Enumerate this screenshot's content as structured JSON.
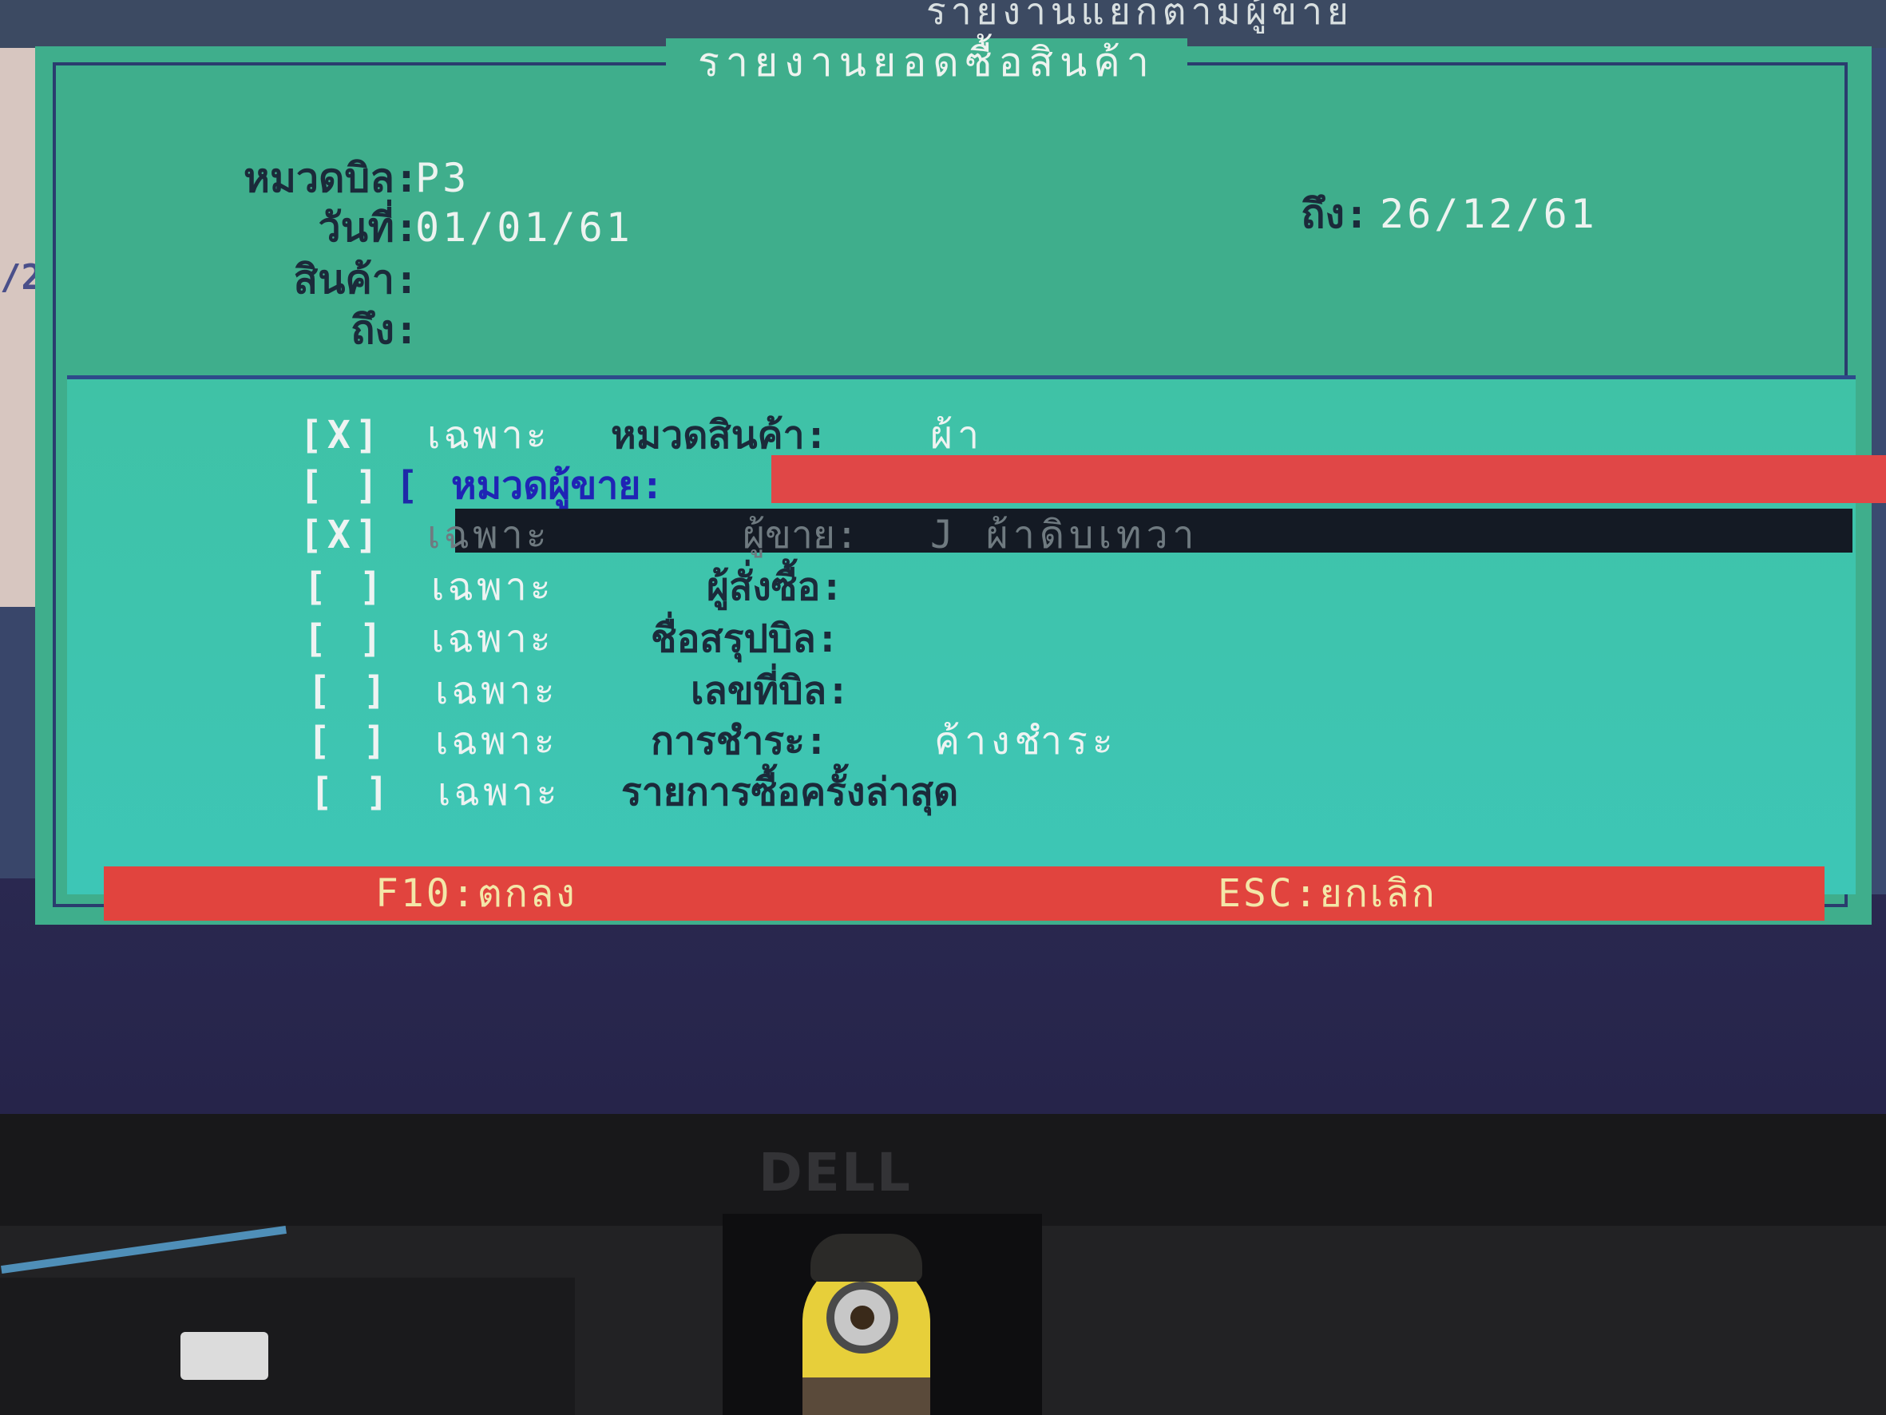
{
  "background": {
    "window_title": "รายงานแยกตามผู้ขาย",
    "left_fragment": "/2"
  },
  "dialog": {
    "title": "รายงานยอดซื้อสินค้า",
    "fields": {
      "bill_category_label": "หมวดบิล:",
      "bill_category_value": "P3",
      "date_label": "วันที่:",
      "date_from_value": "01/01/61",
      "date_to_label": "ถึง:",
      "date_to_value": "26/12/61",
      "product_label": "สินค้า:",
      "product_value": "",
      "product_to_label": "ถึง:",
      "product_to_value": ""
    },
    "options": [
      {
        "check": "[X]",
        "only": "เฉพาะ",
        "label": "หมวดสินค้า:",
        "value": "ผ้า"
      },
      {
        "check": "[ ]",
        "only": "",
        "label": "หมวดผู้ขาย:",
        "value": ""
      },
      {
        "check": "[X]",
        "only": "เฉพาะ",
        "label": "ผู้ขาย:",
        "value": "J ผ้าดิบเทวา"
      },
      {
        "check": "[ ]",
        "only": "เฉพาะ",
        "label": "ผู้สั่งซื้อ:",
        "value": ""
      },
      {
        "check": "[ ]",
        "only": "เฉพาะ",
        "label": "ชื่อสรุปบิล:",
        "value": ""
      },
      {
        "check": "[ ]",
        "only": "เฉพาะ",
        "label": "เลขที่บิล:",
        "value": ""
      },
      {
        "check": "[ ]",
        "only": "เฉพาะ",
        "label": "การชำระ:",
        "value": "ค้างชำระ"
      },
      {
        "check": "[ ]",
        "only": "เฉพาะ",
        "label": "รายการซื้อครั้งล่าสุด",
        "value": ""
      }
    ],
    "focus_bracket": "[",
    "footer": {
      "ok": "F10:ตกลง",
      "cancel": "ESC:ยกเลิก"
    }
  },
  "monitor": {
    "brand": "DELL"
  },
  "colors": {
    "dialog_bg": "#3fae8c",
    "lower_bg": "#3dc3ae",
    "highlight_red": "#e04747",
    "footer_red": "#e1443e",
    "footer_text": "#f3e7a8",
    "focus_blue": "#1f24b5"
  }
}
